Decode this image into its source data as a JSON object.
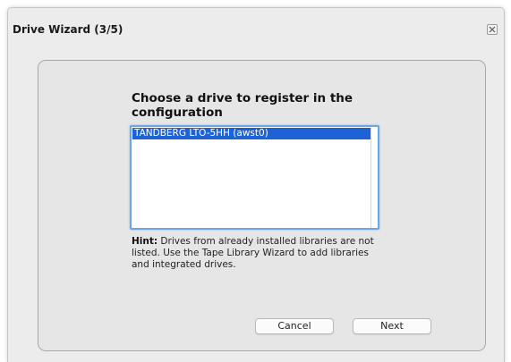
{
  "window": {
    "title": "Drive Wizard (3/5)",
    "close_icon": "close-icon"
  },
  "main": {
    "heading": "Choose a drive to register in the configuration",
    "drive_list": {
      "items": [
        "TANDBERG LTO-5HH (awst0)"
      ],
      "selected_index": 0
    },
    "hint": {
      "label": "Hint:",
      "text": " Drives from already installed libraries are not listed. Use the Tape Library Wizard to add libraries and integrated drives."
    }
  },
  "buttons": {
    "cancel_label": "Cancel",
    "next_label": "Next"
  },
  "colors": {
    "selection": "#1d63d6",
    "focus_ring": "#6ea5e3",
    "dialog_background": "#ececec"
  }
}
